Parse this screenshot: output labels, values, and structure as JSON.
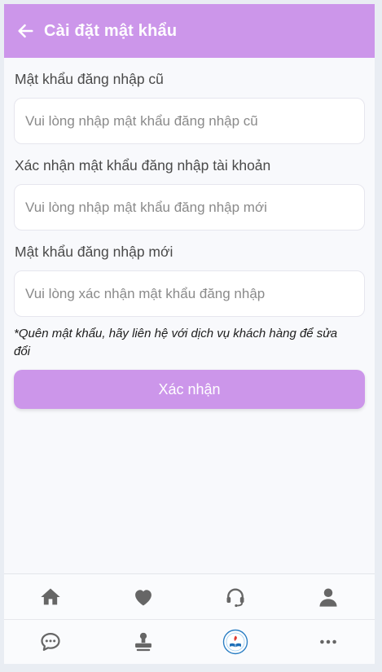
{
  "header": {
    "title": "Cài đặt mật khẩu",
    "back_icon": "arrow-left-icon"
  },
  "form": {
    "old_password": {
      "label": "Mật khẩu đăng nhập cũ",
      "placeholder": "Vui lòng nhập mật khẩu đăng nhập cũ",
      "value": ""
    },
    "confirm_password": {
      "label": "Xác nhận mật khẩu đăng nhập tài khoản",
      "placeholder": "Vui lòng nhập mật khẩu đăng nhập mới",
      "value": ""
    },
    "new_password": {
      "label": "Mật khẩu đăng nhập mới",
      "placeholder": "Vui lòng xác nhận mật khẩu đăng nhập",
      "value": ""
    },
    "note": "*Quên mật khẩu, hãy liên hệ với dịch vụ khách hàng để sửa đổi",
    "submit_label": "Xác nhận"
  },
  "bottom_nav": {
    "row1": [
      "home-icon",
      "heart-icon",
      "headset-icon",
      "user-icon"
    ],
    "row2": [
      "chat-icon",
      "stamp-icon",
      "logo-icon",
      "more-icon"
    ]
  },
  "colors": {
    "accent": "#cc96ea",
    "icon": "#666666"
  }
}
